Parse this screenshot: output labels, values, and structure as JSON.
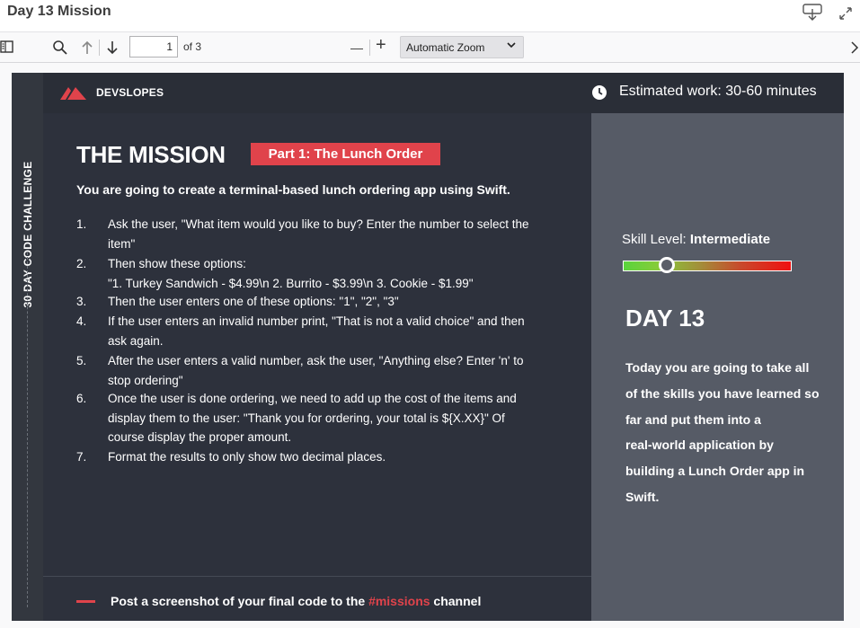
{
  "window": {
    "title": "Day 13 Mission"
  },
  "toolbar": {
    "page_current": "1",
    "page_of": "of 3",
    "zoom_label": "Automatic Zoom",
    "zoom_minus": "—",
    "zoom_plus": "+"
  },
  "document": {
    "side_label": "30 DAY CODE CHALLENGE",
    "brand": "DEVSLOPES",
    "estimate": "Estimated work: 30-60 minutes",
    "mission_title": "THE MISSION",
    "part_badge": "Part 1: The Lunch Order",
    "intro": "You are going to create a terminal-based lunch ordering app using Swift.",
    "steps": [
      {
        "num": "1.",
        "lines": [
          "Ask the user, \"What item would you like to buy? Enter the number to select the",
          "item\""
        ]
      },
      {
        "num": "2.",
        "lines": [
          "Then show these options:",
          "\"1. Turkey Sandwich - $4.99\\n 2. Burrito - $3.99\\n 3. Cookie - $1.99\""
        ]
      },
      {
        "num": "3.",
        "lines": [
          "Then the user enters one of these options: \"1\", \"2\", \"3\""
        ]
      },
      {
        "num": "4.",
        "lines": [
          "If the user enters an invalid number print, \"That is not a valid choice\" and then",
          "ask again."
        ]
      },
      {
        "num": "5.",
        "lines": [
          "After the user enters a valid number, ask the user, \"Anything else? Enter 'n' to",
          "stop ordering\""
        ]
      },
      {
        "num": "6.",
        "lines": [
          "Once the user is done ordering, we need to add up the cost of the items and",
          "display them to the user: \"Thank you for ordering, your total is ${X.XX}\" Of",
          "course display the proper amount."
        ]
      },
      {
        "num": "7.",
        "lines": [
          "Format the results to only show two decimal places."
        ]
      }
    ],
    "footer_before": "Post a screenshot of your final code to the ",
    "footer_link": "#missions",
    "footer_after": " channel",
    "skill_prefix": "Skill Level: ",
    "skill_value": "Intermediate",
    "skill_level_fraction": 0.26,
    "day_title": "DAY 13",
    "day_desc_lines": [
      "Today you are going to take all",
      "of the skills you have learned so",
      "far and put them into a",
      "real-world application by",
      "building a Lunch Order app in",
      "Swift."
    ]
  },
  "colors": {
    "accent_red": "#e0434b",
    "page_bg": "#2d313c",
    "panel_bg": "#565b66"
  },
  "icons": [
    "sidebar-toggle-icon",
    "search-icon",
    "arrow-up-icon",
    "arrow-down-icon",
    "download-icon",
    "expand-icon",
    "chevron-right-icon",
    "clock-icon",
    "devslopes-logo-icon"
  ]
}
